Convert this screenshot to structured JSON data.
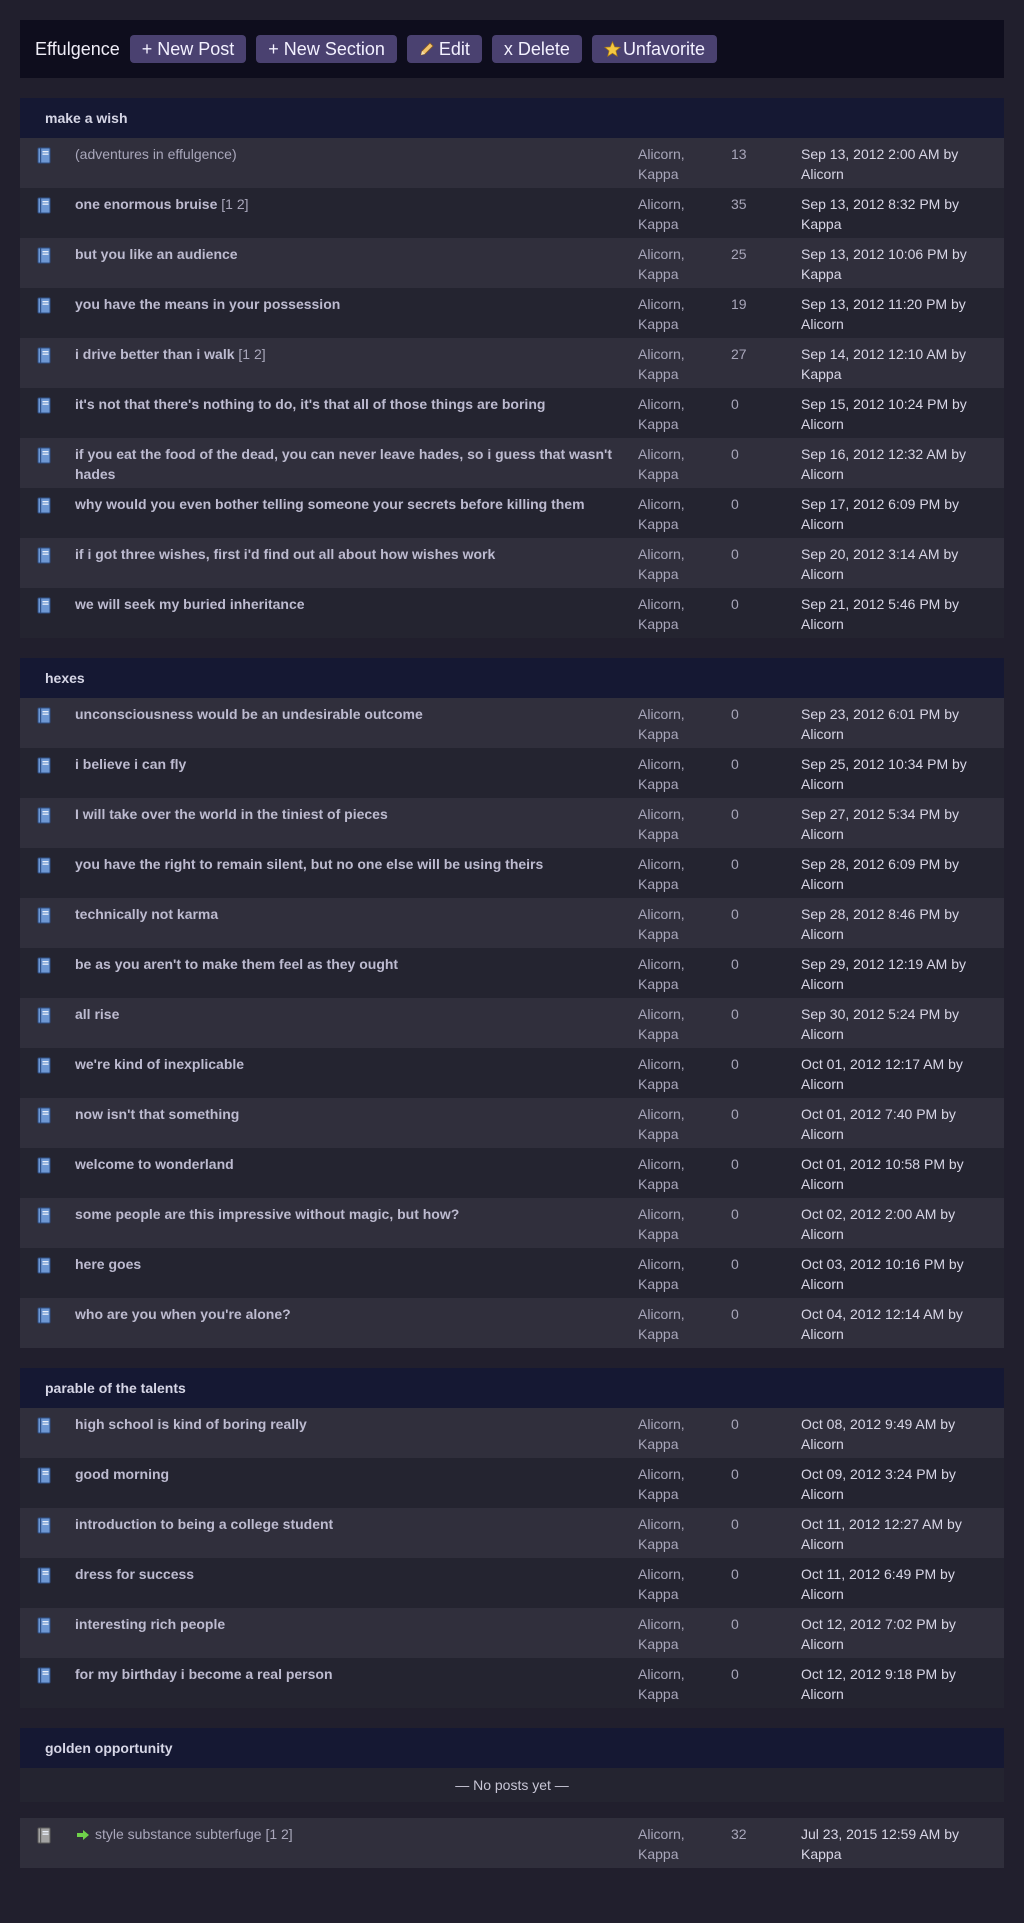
{
  "toolbar": {
    "forum_title": "Effulgence",
    "new_post": "+ New Post",
    "new_section": "+ New Section",
    "edit": "Edit",
    "delete": "x Delete",
    "unfavorite": "Unfavorite"
  },
  "sections": [
    {
      "name": "make a wish",
      "rows": [
        {
          "title": "(adventures in effulgence)",
          "pages": "",
          "authors": "Alicorn, Kappa",
          "replies": "13",
          "last_time": "Sep 13, 2012 2:00 AM by",
          "last_by": "Alicorn"
        },
        {
          "title": "one enormous bruise",
          "pages": "[1 2]",
          "authors": "Alicorn, Kappa",
          "replies": "35",
          "last_time": "Sep 13, 2012 8:32 PM by",
          "last_by": "Kappa"
        },
        {
          "title": "but you like an audience",
          "pages": "",
          "authors": "Alicorn, Kappa",
          "replies": "25",
          "last_time": "Sep 13, 2012 10:06 PM by",
          "last_by": "Kappa"
        },
        {
          "title": "you have the means in your possession",
          "pages": "",
          "authors": "Alicorn, Kappa",
          "replies": "19",
          "last_time": "Sep 13, 2012 11:20 PM by",
          "last_by": "Alicorn"
        },
        {
          "title": "i drive better than i walk",
          "pages": "[1 2]",
          "authors": "Alicorn, Kappa",
          "replies": "27",
          "last_time": "Sep 14, 2012 12:10 AM by",
          "last_by": "Kappa"
        },
        {
          "title": "it's not that there's nothing to do, it's that all of those things are boring",
          "pages": "",
          "authors": "Alicorn, Kappa",
          "replies": "0",
          "last_time": "Sep 15, 2012 10:24 PM by",
          "last_by": "Alicorn"
        },
        {
          "title": "if you eat the food of the dead, you can never leave hades, so i guess that wasn't hades",
          "pages": "",
          "authors": "Alicorn, Kappa",
          "replies": "0",
          "last_time": "Sep 16, 2012 12:32 AM by",
          "last_by": "Alicorn"
        },
        {
          "title": "why would you even bother telling someone your secrets before killing them",
          "pages": "",
          "authors": "Alicorn, Kappa",
          "replies": "0",
          "last_time": "Sep 17, 2012 6:09 PM by",
          "last_by": "Alicorn"
        },
        {
          "title": "if i got three wishes, first i'd find out all about how wishes work",
          "pages": "",
          "authors": "Alicorn, Kappa",
          "replies": "0",
          "last_time": "Sep 20, 2012 3:14 AM by",
          "last_by": "Alicorn"
        },
        {
          "title": "we will seek my buried inheritance",
          "pages": "",
          "authors": "Alicorn, Kappa",
          "replies": "0",
          "last_time": "Sep 21, 2012 5:46 PM by",
          "last_by": "Alicorn"
        }
      ]
    },
    {
      "name": "hexes",
      "rows": [
        {
          "title": "unconsciousness would be an undesirable outcome",
          "pages": "",
          "authors": "Alicorn, Kappa",
          "replies": "0",
          "last_time": "Sep 23, 2012 6:01 PM by",
          "last_by": "Alicorn"
        },
        {
          "title": "i believe i can fly",
          "pages": "",
          "authors": "Alicorn, Kappa",
          "replies": "0",
          "last_time": "Sep 25, 2012 10:34 PM by",
          "last_by": "Alicorn"
        },
        {
          "title": "I will take over the world in the tiniest of pieces",
          "pages": "",
          "authors": "Alicorn, Kappa",
          "replies": "0",
          "last_time": "Sep 27, 2012 5:34 PM by",
          "last_by": "Alicorn"
        },
        {
          "title": "you have the right to remain silent, but no one else will be using theirs",
          "pages": "",
          "authors": "Alicorn, Kappa",
          "replies": "0",
          "last_time": "Sep 28, 2012 6:09 PM by",
          "last_by": "Alicorn"
        },
        {
          "title": "technically not karma",
          "pages": "",
          "authors": "Alicorn, Kappa",
          "replies": "0",
          "last_time": "Sep 28, 2012 8:46 PM by",
          "last_by": "Alicorn"
        },
        {
          "title": "be as you aren't to make them feel as they ought",
          "pages": "",
          "authors": "Alicorn, Kappa",
          "replies": "0",
          "last_time": "Sep 29, 2012 12:19 AM by",
          "last_by": "Alicorn"
        },
        {
          "title": "all rise",
          "pages": "",
          "authors": "Alicorn, Kappa",
          "replies": "0",
          "last_time": "Sep 30, 2012 5:24 PM by",
          "last_by": "Alicorn"
        },
        {
          "title": "we're kind of inexplicable",
          "pages": "",
          "authors": "Alicorn, Kappa",
          "replies": "0",
          "last_time": "Oct 01, 2012 12:17 AM by",
          "last_by": "Alicorn"
        },
        {
          "title": "now isn't that something",
          "pages": "",
          "authors": "Alicorn, Kappa",
          "replies": "0",
          "last_time": "Oct 01, 2012 7:40 PM by",
          "last_by": "Alicorn"
        },
        {
          "title": "welcome to wonderland",
          "pages": "",
          "authors": "Alicorn, Kappa",
          "replies": "0",
          "last_time": "Oct 01, 2012 10:58 PM by",
          "last_by": "Alicorn"
        },
        {
          "title": "some people are this impressive without magic, but how?",
          "pages": "",
          "authors": "Alicorn, Kappa",
          "replies": "0",
          "last_time": "Oct 02, 2012 2:00 AM by",
          "last_by": "Alicorn"
        },
        {
          "title": "here goes",
          "pages": "",
          "authors": "Alicorn, Kappa",
          "replies": "0",
          "last_time": "Oct 03, 2012 10:16 PM by",
          "last_by": "Alicorn"
        },
        {
          "title": "who are you when you're alone?",
          "pages": "",
          "authors": "Alicorn, Kappa",
          "replies": "0",
          "last_time": "Oct 04, 2012 12:14 AM by",
          "last_by": "Alicorn"
        }
      ]
    },
    {
      "name": "parable of the talents",
      "rows": [
        {
          "title": "high school is kind of boring really",
          "pages": "",
          "authors": "Alicorn, Kappa",
          "replies": "0",
          "last_time": "Oct 08, 2012 9:49 AM by",
          "last_by": "Alicorn"
        },
        {
          "title": "good morning",
          "pages": "",
          "authors": "Alicorn, Kappa",
          "replies": "0",
          "last_time": "Oct 09, 2012 3:24 PM by",
          "last_by": "Alicorn"
        },
        {
          "title": "introduction to being a college student",
          "pages": "",
          "authors": "Alicorn, Kappa",
          "replies": "0",
          "last_time": "Oct 11, 2012 12:27 AM by",
          "last_by": "Alicorn"
        },
        {
          "title": "dress for success",
          "pages": "",
          "authors": "Alicorn, Kappa",
          "replies": "0",
          "last_time": "Oct 11, 2012 6:49 PM by",
          "last_by": "Alicorn"
        },
        {
          "title": "interesting rich people",
          "pages": "",
          "authors": "Alicorn, Kappa",
          "replies": "0",
          "last_time": "Oct 12, 2012 7:02 PM by",
          "last_by": "Alicorn"
        },
        {
          "title": "for my birthday i become a real person",
          "pages": "",
          "authors": "Alicorn, Kappa",
          "replies": "0",
          "last_time": "Oct 12, 2012 9:18 PM by",
          "last_by": "Alicorn"
        }
      ]
    },
    {
      "name": "golden opportunity",
      "empty_text": "— No posts yet —"
    }
  ],
  "unsectioned": {
    "title": "style substance subterfuge",
    "pages": "[1 2]",
    "authors": "Alicorn, Kappa",
    "replies": "32",
    "last_time": "Jul 23, 2015 12:59 AM by",
    "last_by": "Kappa"
  },
  "icons": {
    "post": "blue-book-icon",
    "unsectioned_post": "grey-book-icon",
    "arrow": "green-arrow-icon",
    "edit": "pencil-icon",
    "unfavorite": "star-icon"
  },
  "colors": {
    "background": "#211f2d",
    "toolbar": "#0e0d1d",
    "button": "#4a4170",
    "section_header": "#151833",
    "row_odd": "#302f3c",
    "row_even": "#242430"
  }
}
